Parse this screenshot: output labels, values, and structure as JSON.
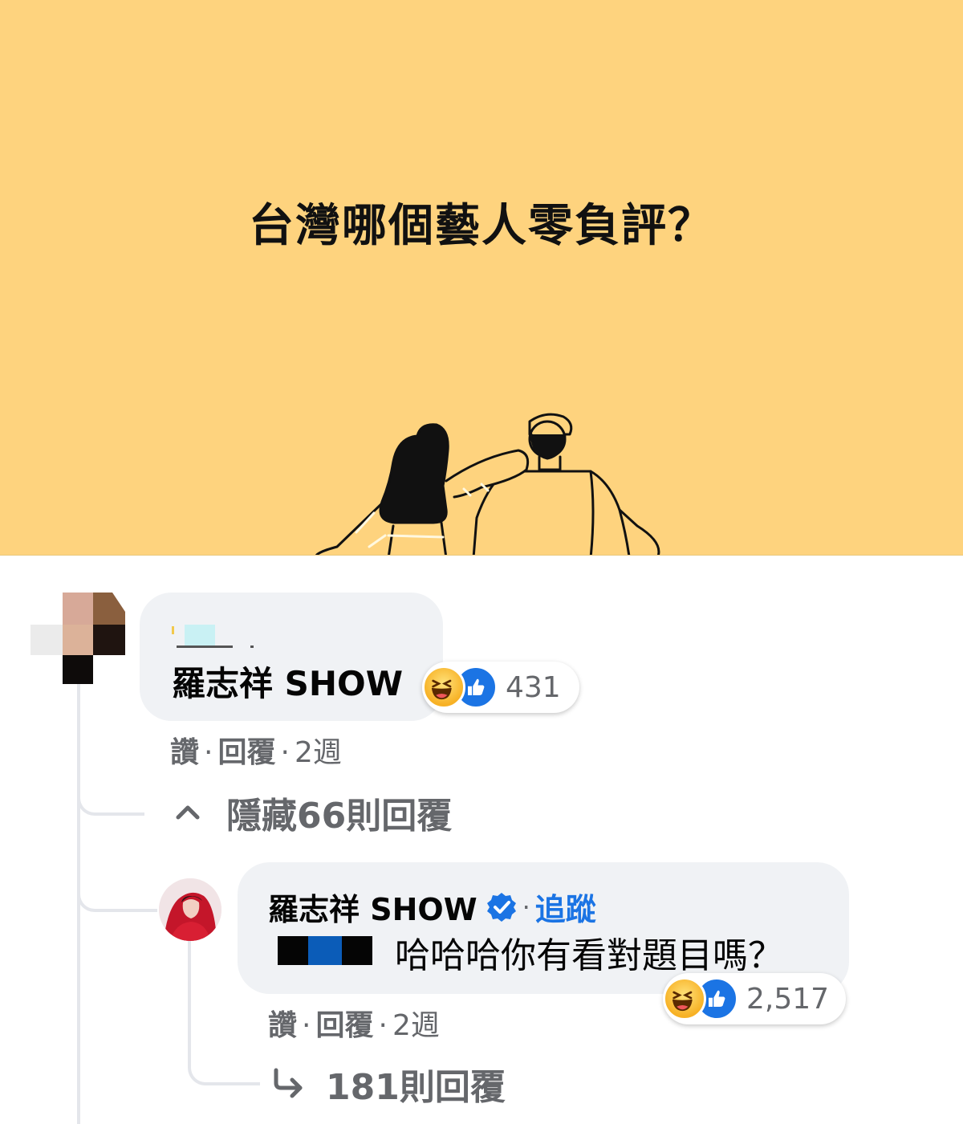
{
  "banner": {
    "question": "台灣哪個藝人零負評？",
    "background": "#fed37e"
  },
  "comment1": {
    "author_masked": true,
    "text": "羅志祥 SHOW",
    "reaction_count": "431",
    "reactions": [
      "haha-icon",
      "like-icon"
    ],
    "actions": {
      "like": "讚",
      "reply": "回覆",
      "sep": "·",
      "time": "2週"
    }
  },
  "hide_replies": {
    "label": "隱藏66則回覆"
  },
  "comment2": {
    "author": "羅志祥 SHOW",
    "verified": true,
    "sep": "·",
    "follow": "追蹤",
    "text": "哈哈哈你有看對題目嗎？",
    "reaction_count": "2,517",
    "reactions": [
      "haha-icon",
      "like-icon"
    ],
    "actions": {
      "like": "讚",
      "reply": "回覆",
      "sep": "·",
      "time": "2週"
    }
  },
  "more_replies": {
    "label": "181則回覆"
  },
  "colors": {
    "accent": "#1b74e4",
    "muted": "#65676b",
    "bubble": "#f0f2f5"
  }
}
